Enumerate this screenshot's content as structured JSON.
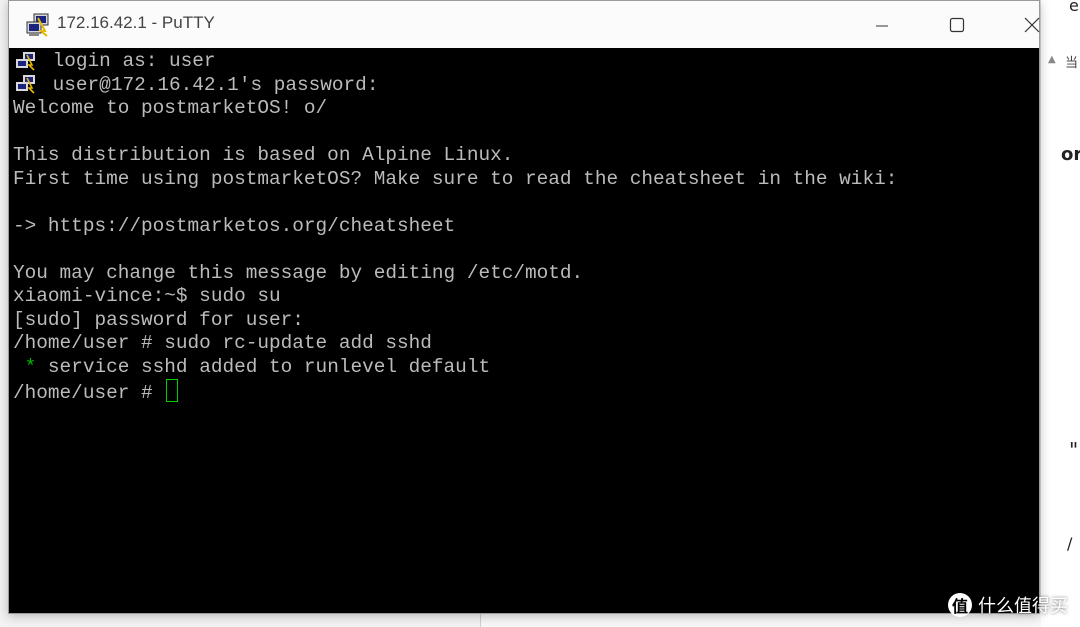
{
  "window": {
    "title": "172.16.42.1 - PuTTY"
  },
  "terminal": {
    "lines": [
      " login as: user",
      " user@172.16.42.1's password:",
      "Welcome to postmarketOS! o/",
      "",
      "This distribution is based on Alpine Linux.",
      "First time using postmarketOS? Make sure to read the cheatsheet in the wiki:",
      "",
      "-> https://postmarketos.org/cheatsheet",
      "",
      "You may change this message by editing /etc/motd.",
      "xiaomi-vince:~$ sudo su",
      "[sudo] password for user:",
      "/home/user # sudo rc-update add sshd",
      "",
      "/home/user # "
    ],
    "service_star": " *",
    "service_text": " service sshd added to runlevel default",
    "colors": {
      "background": "#000000",
      "foreground": "#bbbbbb",
      "star": "#00bb00",
      "cursor": "#00d000"
    }
  },
  "background_window": {
    "fragment_top": "e",
    "fragment_cjk": "当",
    "fragment_mid": "or",
    "fragment_quote": "\"",
    "fragment_slash": "/"
  },
  "watermark": {
    "logo": "值",
    "text": "什么值得买"
  },
  "icons": [
    "putty-icon",
    "minimize-icon",
    "maximize-icon",
    "close-icon"
  ]
}
